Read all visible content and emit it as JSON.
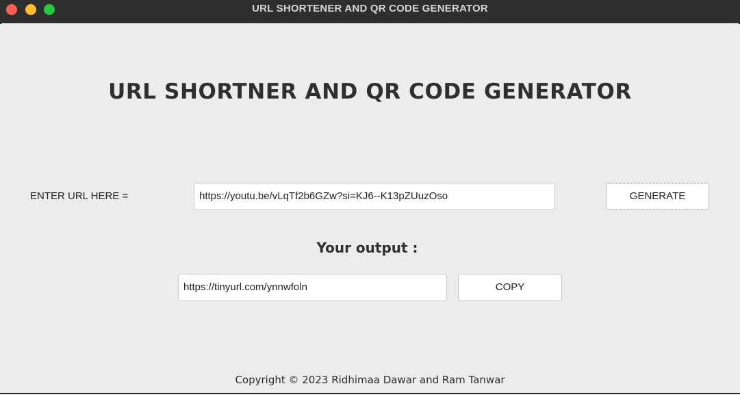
{
  "window": {
    "title": "URL SHORTENER AND QR CODE GENERATOR",
    "controls": {
      "close": "close-icon",
      "minimize": "minimize-icon",
      "maximize": "maximize-icon",
      "colors": {
        "close": "#ff5f57",
        "minimize": "#febc2e",
        "maximize": "#28c840"
      }
    }
  },
  "main": {
    "heading": "URL SHORTNER AND QR CODE GENERATOR",
    "url_label": "ENTER URL HERE =",
    "url_input_value": "https://youtu.be/vLqTf2b6GZw?si=KJ6--K13pZUuzOso",
    "generate_label": "GENERATE",
    "output_label": "Your output :",
    "output_value": "https://tinyurl.com/ynnwfoln",
    "copy_label": "COPY"
  },
  "footer": {
    "copyright": "Copyright © 2023 Ridhimaa Dawar and Ram Tanwar"
  }
}
